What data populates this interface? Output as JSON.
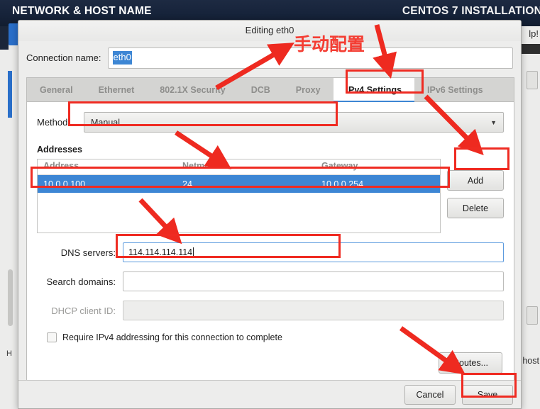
{
  "background": {
    "header_title": "NETWORK & HOST NAME",
    "header_right": "CENTOS 7 INSTALLATION",
    "help_text": "lp!",
    "host_text": "host",
    "left_text": "H"
  },
  "dialog": {
    "title": "Editing eth0",
    "connection_name_label": "Connection name:",
    "connection_name_value": "eth0",
    "tabs": [
      {
        "label": "General",
        "active": false
      },
      {
        "label": "Ethernet",
        "active": false
      },
      {
        "label": "802.1X Security",
        "active": false
      },
      {
        "label": "DCB",
        "active": false
      },
      {
        "label": "Proxy",
        "active": false
      },
      {
        "label": "IPv4 Settings",
        "active": true
      },
      {
        "label": "IPv6 Settings",
        "active": false
      }
    ],
    "method": {
      "label": "Method:",
      "value": "Manual",
      "arrow": "chevron-down-icon"
    },
    "addresses": {
      "section_title": "Addresses",
      "columns": [
        "Address",
        "Netmask",
        "Gateway"
      ],
      "rows": [
        {
          "address": "10.0.0.100",
          "netmask": "24",
          "gateway": "10.0.0.254",
          "selected": true
        }
      ],
      "add_label": "Add",
      "delete_label": "Delete"
    },
    "fields": [
      {
        "label": "DNS servers:",
        "value": "114.114.114.114",
        "state": "focused"
      },
      {
        "label": "Search domains:",
        "value": "",
        "state": "normal"
      },
      {
        "label": "DHCP client ID:",
        "value": "",
        "state": "disabled"
      }
    ],
    "require_ipv4_label": "Require IPv4 addressing for this connection to complete",
    "require_ipv4_checked": false,
    "routes_label": "Routes...",
    "cancel_label": "Cancel",
    "save_label": "Save"
  },
  "annotations": {
    "chinese_note": "手动配置",
    "accent_color": "#ef2b22"
  }
}
